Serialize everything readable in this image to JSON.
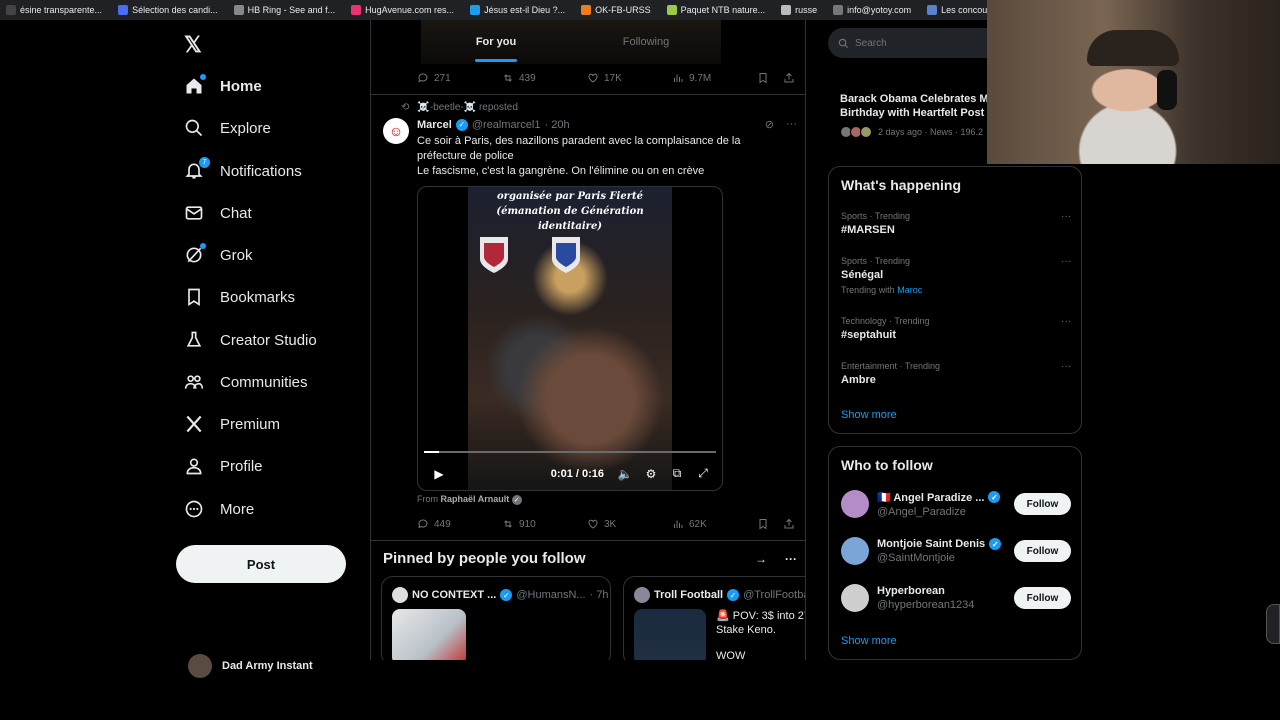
{
  "bookmarks": [
    {
      "label": "ésine transparente...",
      "color": "#444"
    },
    {
      "label": "Sélection des candi...",
      "color": "#4a6cf7"
    },
    {
      "label": "HB Ring - See and f...",
      "color": "#888"
    },
    {
      "label": "HugAvenue.com res...",
      "color": "#e8336e"
    },
    {
      "label": "Jésus est-il Dieu ?...",
      "color": "#1d9bf0"
    },
    {
      "label": "OK-FB-URSS",
      "color": "#f07d1d"
    },
    {
      "label": "Paquet NTB nature...",
      "color": "#9c4"
    },
    {
      "label": "russe",
      "color": "#bbb"
    },
    {
      "label": "info@yotoy.com",
      "color": "#777"
    },
    {
      "label": "Les concours d'aute...",
      "color": "#5b7fd1"
    }
  ],
  "nav": {
    "items": [
      {
        "label": "Home",
        "icon": "home-icon",
        "active": true
      },
      {
        "label": "Explore",
        "icon": "search-icon"
      },
      {
        "label": "Notifications",
        "icon": "bell-icon",
        "badge": "7"
      },
      {
        "label": "Chat",
        "icon": "mail-icon"
      },
      {
        "label": "Grok",
        "icon": "grok-icon"
      },
      {
        "label": "Bookmarks",
        "icon": "bookmark-icon"
      },
      {
        "label": "Creator Studio",
        "icon": "flask-icon"
      },
      {
        "label": "Communities",
        "icon": "people-icon"
      },
      {
        "label": "Premium",
        "icon": "x-icon"
      },
      {
        "label": "Profile",
        "icon": "person-icon"
      },
      {
        "label": "More",
        "icon": "more-circle-icon"
      }
    ],
    "post_label": "Post",
    "account_name": "Dad Army Instant"
  },
  "tabs": {
    "for_you": "For you",
    "following": "Following"
  },
  "prev_tweet_stats": {
    "replies": "271",
    "reposts": "439",
    "likes": "17K",
    "views": "9.7M"
  },
  "tweet": {
    "reposted_by": "☠️-beetle-☠️ reposted",
    "name": "Marcel",
    "handle": "@realmarcel1",
    "time": "· 20h",
    "text_line1": "Ce soir à Paris, des nazillons paradent avec la complaisance de la préfecture de police",
    "text_line2": "Le fascisme, c'est la gangrène. On l'élimine ou on en crève",
    "video_caption": "organisée par Paris Fierté (émanation de Génération identitaire)",
    "video_time": "0:01 / 0:16",
    "video_progress": 0.05,
    "from_label": "From",
    "from_name": "Raphaël Arnault",
    "stats": {
      "replies": "449",
      "reposts": "910",
      "likes": "3K",
      "views": "62K"
    }
  },
  "pinned": {
    "title": "Pinned by people you follow",
    "cards": [
      {
        "name": "NO CONTEXT ...",
        "handle": "@HumansN...",
        "time": "· 7h"
      },
      {
        "name": "Troll Football",
        "handle": "@TrollFootba",
        "text_line1": "🚨 POV: 3$ into 27",
        "text_line2": "Stake Keno.",
        "text_line3": "WOW"
      }
    ]
  },
  "search": {
    "placeholder": "Search"
  },
  "news": {
    "title": "Barack Obama Celebrates M Birthday with Heartfelt Post",
    "meta": "2 days ago · News · 196.2"
  },
  "whats_happening": {
    "title": "What's happening",
    "trends": [
      {
        "category": "Sports · Trending",
        "name": "#MARSEN"
      },
      {
        "category": "Sports · Trending",
        "name": "Sénégal",
        "with_label": "Trending with",
        "with_value": "Maroc"
      },
      {
        "category": "Technology · Trending",
        "name": "#septahuit"
      },
      {
        "category": "Entertainment · Trending",
        "name": "Ambre"
      }
    ],
    "show_more": "Show more"
  },
  "who_to_follow": {
    "title": "Who to follow",
    "accounts": [
      {
        "name": "🇫🇷 Angel Paradize ...",
        "handle": "@Angel_Paradize",
        "verified": true,
        "color": "#b48cc8"
      },
      {
        "name": "Montjoie Saint Denis",
        "handle": "@SaintMontjoie",
        "verified": true,
        "color": "#7aa5d6"
      },
      {
        "name": "Hyperborean",
        "handle": "@hyperborean1234",
        "verified": false,
        "color": "#cfcfcf"
      }
    ],
    "follow_label": "Follow",
    "show_more": "Show more"
  },
  "colors": {
    "accent": "#1d9bf0",
    "background": "#000000",
    "border": "#2f3336",
    "muted": "#71767b"
  }
}
